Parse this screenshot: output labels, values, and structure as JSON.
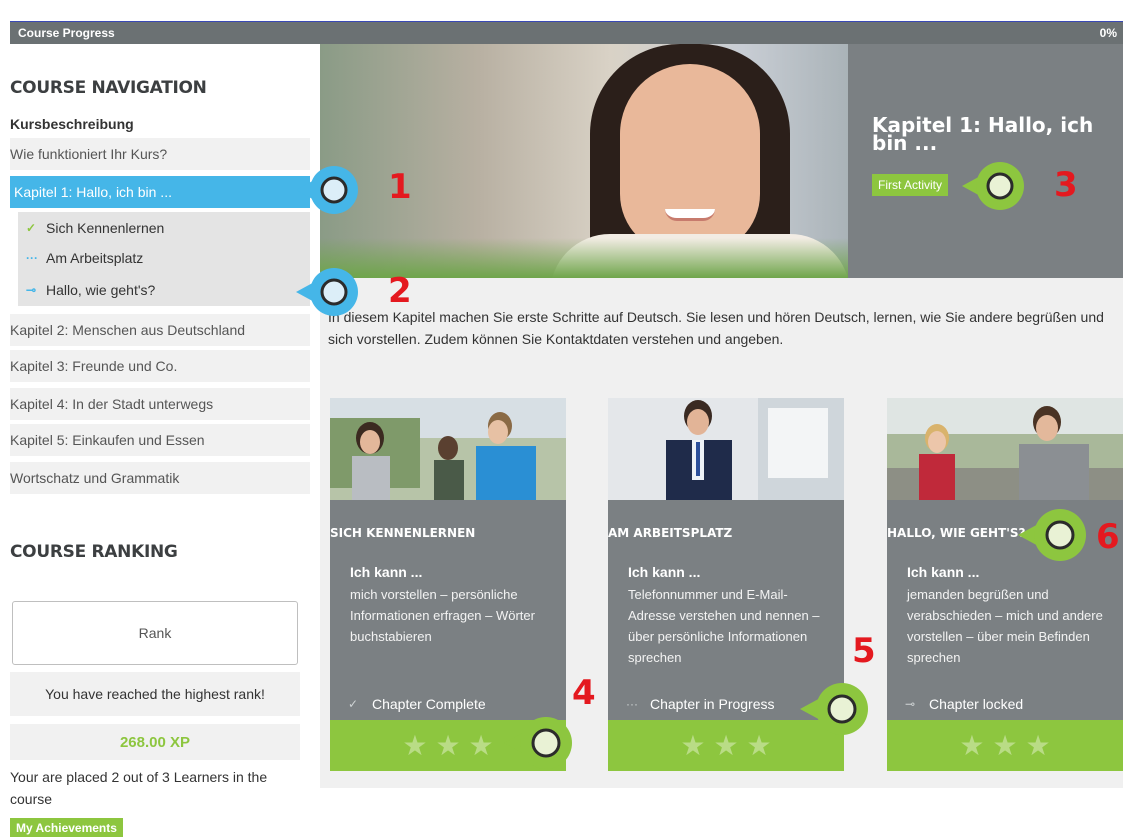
{
  "topbar": {
    "title": "Course Progress",
    "percent": "0%"
  },
  "sidebar": {
    "nav_heading": "COURSE NAVIGATION",
    "description_link": "Kursbeschreibung",
    "items": [
      {
        "label": "Wie funktioniert Ihr Kurs?"
      },
      {
        "label": "Kapitel 1: Hallo, ich bin ..."
      },
      {
        "label": "Sich Kennenlernen",
        "icon": "check-icon",
        "glyph": "✓"
      },
      {
        "label": "Am Arbeitsplatz",
        "icon": "in-progress-icon",
        "glyph": "···"
      },
      {
        "label": "Hallo, wie geht's?",
        "icon": "key-icon",
        "glyph": "⊸"
      },
      {
        "label": "Kapitel 2: Menschen aus Deutschland"
      },
      {
        "label": "Kapitel 3: Freunde und Co."
      },
      {
        "label": "Kapitel 4: In der Stadt unterwegs"
      },
      {
        "label": "Kapitel 5: Einkaufen und Essen"
      },
      {
        "label": "Wortschatz und Grammatik"
      }
    ],
    "ranking_heading": "COURSE RANKING",
    "rank_label": "Rank",
    "rank_message": "You have reached the highest rank!",
    "xp": "268.00 XP",
    "placed_text": "Your are placed 2 out of 3 Learners in the course",
    "achievements_button": "My Achievements"
  },
  "chapter": {
    "title": "Kapitel 1: Hallo, ich bin ...",
    "first_activity": "First Activity",
    "intro": "In diesem Kapitel machen Sie erste Schritte auf Deutsch. Sie lesen und hören Deutsch, lernen, wie Sie andere begrüßen und sich vorstellen. Zudem können Sie Kontaktdaten verstehen und angeben."
  },
  "cards": [
    {
      "title": "SICH KENNENLERNEN",
      "kann": "Ich kann ...",
      "desc": "mich vorstellen – persönliche Informationen erfragen – Wörter buchstabieren",
      "status": "Chapter Complete",
      "status_icon": "check-icon",
      "status_glyph": "✓"
    },
    {
      "title": "AM ARBEITSPLATZ",
      "kann": "Ich kann ...",
      "desc": "Telefonnummer und E-Mail-Adresse verstehen und nennen – über persönliche Informationen sprechen",
      "status": "Chapter in Progress",
      "status_icon": "in-progress-icon",
      "status_glyph": "···"
    },
    {
      "title": "HALLO, WIE GEHT'S?",
      "kann": "Ich kann ...",
      "desc": "jemanden begrüßen und verabschieden – mich und andere vorstellen – über mein Befinden sprechen",
      "status": "Chapter locked",
      "status_icon": "key-icon",
      "status_glyph": "⊸"
    }
  ],
  "stars": "★",
  "markers": [
    "1",
    "2",
    "3",
    "4",
    "5",
    "6"
  ],
  "colors": {
    "accent_blue": "#45b6e8",
    "accent_green": "#8dc63f",
    "panel_gray": "#7b8083",
    "marker_red": "#e4191f"
  }
}
